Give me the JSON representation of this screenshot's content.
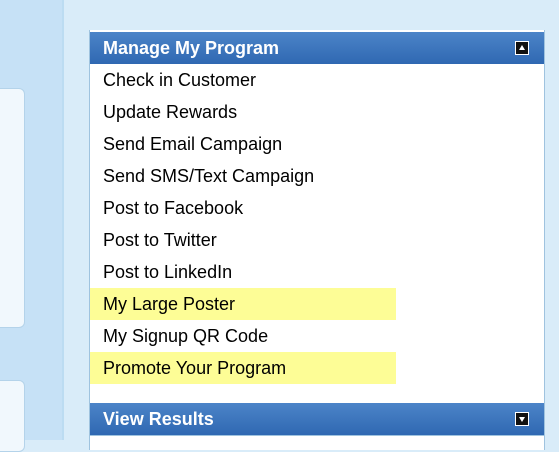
{
  "manage_panel": {
    "title": "Manage My Program",
    "toggle_icon": "collapse-up-icon",
    "items": [
      {
        "label": "Check in Customer",
        "highlighted": false
      },
      {
        "label": "Update Rewards",
        "highlighted": false
      },
      {
        "label": "Send Email Campaign",
        "highlighted": false
      },
      {
        "label": "Send SMS/Text Campaign",
        "highlighted": false
      },
      {
        "label": "Post to Facebook",
        "highlighted": false
      },
      {
        "label": "Post to Twitter",
        "highlighted": false
      },
      {
        "label": "Post to LinkedIn",
        "highlighted": false
      },
      {
        "label": "My Large Poster",
        "highlighted": true
      },
      {
        "label": "My Signup QR Code",
        "highlighted": false
      },
      {
        "label": "Promote Your Program",
        "highlighted": true
      }
    ]
  },
  "results_panel": {
    "title": "View Results",
    "toggle_icon": "expand-down-icon"
  },
  "colors": {
    "header": "#3b74bd",
    "highlight": "#fdfd96",
    "background": "#d9ecf9"
  }
}
